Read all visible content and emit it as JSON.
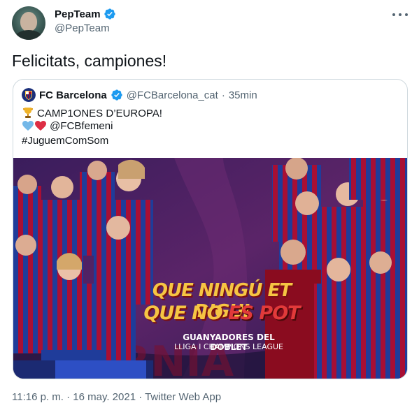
{
  "author": {
    "name": "PepTeam",
    "handle": "@PepTeam",
    "avatar_icon": "person-avatar"
  },
  "tweet": {
    "text": "Felicitats, campiones!"
  },
  "quoted_tweet": {
    "name": "FC Barcelona",
    "handle": "@FCBarcelona_cat",
    "separator": "·",
    "time": "35min",
    "line1": "CAMP1ONES D’EUROPA!",
    "line2_link": "@FCBfemeni",
    "line3": "#JuguemComSom",
    "line1_icon": "trophy-icon",
    "line2_icons": [
      "blue-heart-icon",
      "red-heart-icon"
    ],
    "media": {
      "headline1": "QUE NINGÚ ET DIGUI",
      "headline2_a": "QUE NO",
      "headline2_b": "ES POT",
      "sub1": "GUANYADORES DEL DOBLET",
      "sub2": "LLIGA I CHAMPIONS LEAGUE"
    }
  },
  "footer": {
    "timestamp": "11:16 p. m. · 16 may. 2021 · Twitter Web App"
  },
  "colors": {
    "verified": "#1d9bf0",
    "muted": "#536471",
    "border": "#cfd9de",
    "barca_blue": "#1a2f7a",
    "barca_red": "#a50d2b",
    "gold": "#f6c543"
  }
}
